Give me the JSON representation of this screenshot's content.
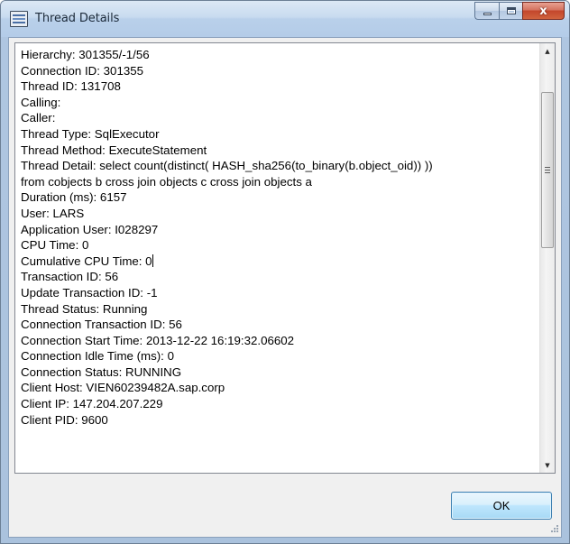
{
  "window": {
    "title": "Thread Details",
    "close_glyph": "x"
  },
  "details": {
    "lines": [
      "Hierarchy: 301355/-1/56",
      "Connection ID: 301355",
      "Thread ID: 131708",
      "Calling:",
      "Caller:",
      "Thread Type: SqlExecutor",
      "Thread Method: ExecuteStatement",
      "Thread Detail: select count(distinct( HASH_sha256(to_binary(b.object_oid)) ))",
      "from cobjects b cross join objects c cross join objects a",
      "Duration (ms): 6157",
      "User: LARS",
      "Application User: I028297",
      "CPU Time: 0",
      "Cumulative CPU Time: 0",
      "Transaction ID: 56",
      "Update Transaction ID: -1",
      "Thread Status: Running",
      "Connection Transaction ID: 56",
      "Connection Start Time: 2013-12-22 16:19:32.06602",
      "Connection Idle Time (ms): 0",
      "Connection Status: RUNNING",
      "Client Host: VIEN60239482A.sap.corp",
      "Client IP: 147.204.207.229",
      "Client PID: 9600"
    ]
  },
  "buttons": {
    "ok_label": "OK"
  },
  "icons": {
    "app": "window-icon",
    "minimize": "minimize-icon",
    "maximize": "maximize-icon",
    "close": "close-icon",
    "scroll_up": "scroll-up-arrow-icon",
    "scroll_down": "scroll-down-arrow-icon",
    "grip": "scroll-grip-icon",
    "resize": "resize-grip-icon"
  },
  "colors": {
    "titlebar": "#c8dbef",
    "close_button": "#c3462c",
    "ok_button_border": "#3c7fb1"
  }
}
